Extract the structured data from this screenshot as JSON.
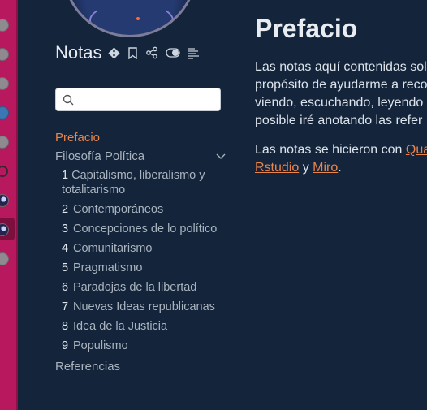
{
  "colors": {
    "dock": "#b8195e",
    "background": "#13243b",
    "accent": "#e9844a",
    "text_muted": "#aab4bf",
    "text": "#dce3ea"
  },
  "dock": {
    "icons": [
      "app-icon",
      "app-icon",
      "app-icon",
      "wordpress-icon",
      "app-icon",
      "github-icon",
      "image-icon",
      "image-icon",
      "app-icon"
    ]
  },
  "sidebar": {
    "site_title": "Notas",
    "tools": [
      "git-icon",
      "bookmark-icon",
      "share-icon",
      "toggle-icon",
      "reader-icon"
    ],
    "search": {
      "placeholder": "",
      "value": ""
    },
    "nav": {
      "prefacio": "Prefacio",
      "section": "Filosofía Política",
      "chapters": [
        {
          "num": "1",
          "label": "Capitalismo, liberalismo y totalitarismo"
        },
        {
          "num": "2",
          "label": "Contemporáneos"
        },
        {
          "num": "3",
          "label": "Concepciones de lo político"
        },
        {
          "num": "4",
          "label": "Comunitarismo"
        },
        {
          "num": "5",
          "label": "Pragmatismo"
        },
        {
          "num": "6",
          "label": "Paradojas de la libertad"
        },
        {
          "num": "7",
          "label": "Nuevas Ideas republicanas"
        },
        {
          "num": "8",
          "label": "Idea de la Justicia"
        },
        {
          "num": "9",
          "label": "Populismo"
        }
      ],
      "referencias": "Referencias"
    }
  },
  "main": {
    "title": "Prefacio",
    "p1_lines": [
      "Las notas aquí contenidas sol",
      "propósito de ayudarme a reco",
      "viendo, escuchando, leyendo",
      "posible iré anotando las refer"
    ],
    "p2_text": "Las notas se hicieron con ",
    "p2_link1": "Qua",
    "p2_link2": "Rstudio",
    "p2_and": " y ",
    "p2_link3": "Miro",
    "p2_end": "."
  }
}
